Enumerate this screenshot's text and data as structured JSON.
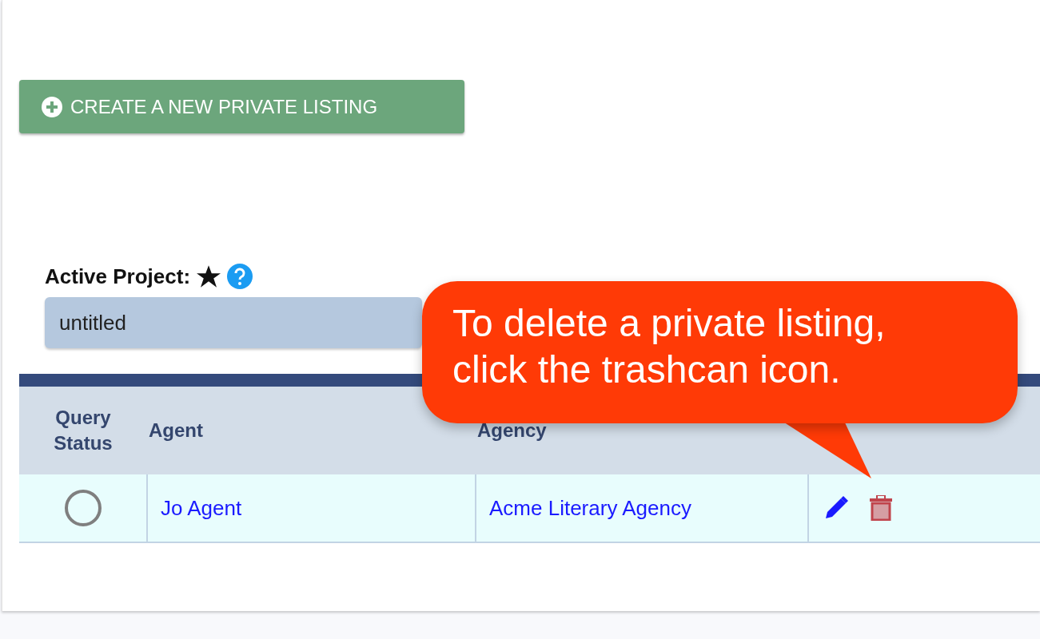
{
  "create_button": {
    "label": "CREATE A NEW PRIVATE LISTING"
  },
  "active_project": {
    "label": "Active Project:",
    "value": "untitled"
  },
  "table": {
    "columns": [
      "Query\nStatus",
      "Agent",
      "Agency"
    ],
    "rows": [
      {
        "agent": "Jo Agent",
        "agency": "Acme Literary Agency"
      }
    ]
  },
  "callout": {
    "text": "To delete a private listing,\nclick the trashcan icon."
  }
}
